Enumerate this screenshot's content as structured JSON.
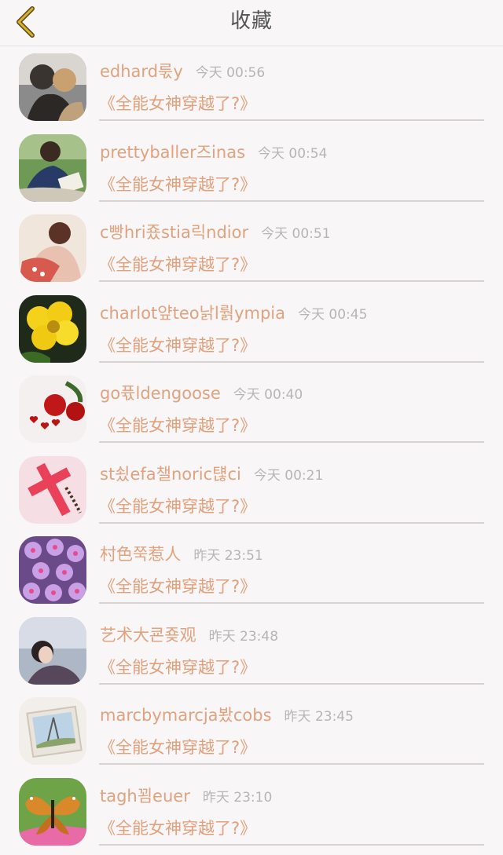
{
  "header": {
    "title": "收藏",
    "back_icon": "chevron-left-icon",
    "accent": "#c9a21a"
  },
  "favorites": [
    {
      "username": "edhard룫y",
      "time": "今天 00:56",
      "book": "《全能女神穿越了?》",
      "avatar": "couple-kissing"
    },
    {
      "username": "prettyballer즈inas",
      "time": "今天 00:54",
      "book": "《全能女神穿越了?》",
      "avatar": "girl-reading-book"
    },
    {
      "username": "c빵hri죴stia릭ndior",
      "time": "今天 00:51",
      "book": "《全能女神穿越了?》",
      "avatar": "couple-embrace"
    },
    {
      "username": "charlot얖teo낡l뤍ympia",
      "time": "今天 00:45",
      "book": "《全能女神穿越了?》",
      "avatar": "yellow-flower"
    },
    {
      "username": "go퓫ldengoose",
      "time": "今天 00:40",
      "book": "《全能女神穿越了?》",
      "avatar": "red-roses-hearts"
    },
    {
      "username": "st쇴efa챌noric턚ci",
      "time": "今天 00:21",
      "book": "《全能女神穿越了?》",
      "avatar": "pink-cross"
    },
    {
      "username": "村色쭉惹人",
      "time": "昨天 23:51",
      "book": "《全能女神穿越了?》",
      "avatar": "purple-flowers"
    },
    {
      "username": "艺术大쿈죶观",
      "time": "昨天 23:48",
      "book": "《全能女神穿越了?》",
      "avatar": "girl-lying-down"
    },
    {
      "username": "marcbymarcja봤cobs",
      "time": "昨天 23:45",
      "book": "《全能女神穿越了?》",
      "avatar": "eiffel-tower-photo"
    },
    {
      "username": "tagh꾐euer",
      "time": "昨天 23:10",
      "book": "《全能女神穿越了?》",
      "avatar": "butterfly"
    }
  ]
}
